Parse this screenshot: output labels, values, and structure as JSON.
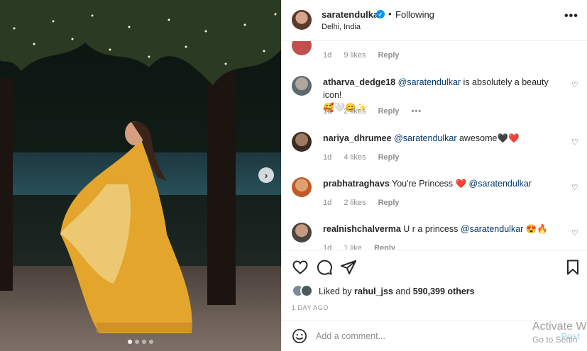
{
  "post": {
    "username": "sarat​endulkar",
    "verified_icon": "verified-badge-icon",
    "dot": "•",
    "follow_status": "Following",
    "location": "Delhi, India",
    "more_icon": "more-options-icon",
    "more_glyph": "•••"
  },
  "comments": [
    {
      "user": "",
      "text": "",
      "time": "1d",
      "likes": "9 likes",
      "reply": "Reply"
    },
    {
      "user": "atharva_dedge18",
      "mention": "@saratendulkar",
      "text": " is absolutely a beauty icon!",
      "emoji": "🥰🤍😊✨",
      "time": "1d",
      "likes": "2 likes",
      "reply": "Reply",
      "options": "•••"
    },
    {
      "user": "nariya_dhrumee",
      "mention": "@saratendulkar",
      "text": " awesome🖤❤️",
      "time": "1d",
      "likes": "4 likes",
      "reply": "Reply"
    },
    {
      "user": "prabhatraghavs",
      "text": "You're Princess ❤️ ",
      "mention": "@saratendulkar",
      "time": "1d",
      "likes": "2 likes",
      "reply": "Reply"
    },
    {
      "user": "realnishchalverma",
      "text": "U r a princess ",
      "mention": "@saratendulkar",
      "emoji": " 😍🔥",
      "time": "1d",
      "likes": "1 like",
      "reply": "Reply"
    }
  ],
  "actions": {
    "liked_prefix": "Liked by",
    "liked_user": "rahul_jss",
    "liked_mid": "and",
    "liked_count": "590,399 others",
    "date": "1 DAY AGO"
  },
  "composer": {
    "placeholder": "Add a comment...",
    "post_label": "Post"
  },
  "watermark": {
    "line1": "Activate W",
    "line2": "Go to Settin"
  },
  "carousel": {
    "next_glyph": "›",
    "current_index": 1,
    "total": 4
  },
  "colors": {
    "link": "#00376b",
    "verified": "#0095f6",
    "muted": "#8e8e8e",
    "post_disabled": "#b2dffc"
  }
}
